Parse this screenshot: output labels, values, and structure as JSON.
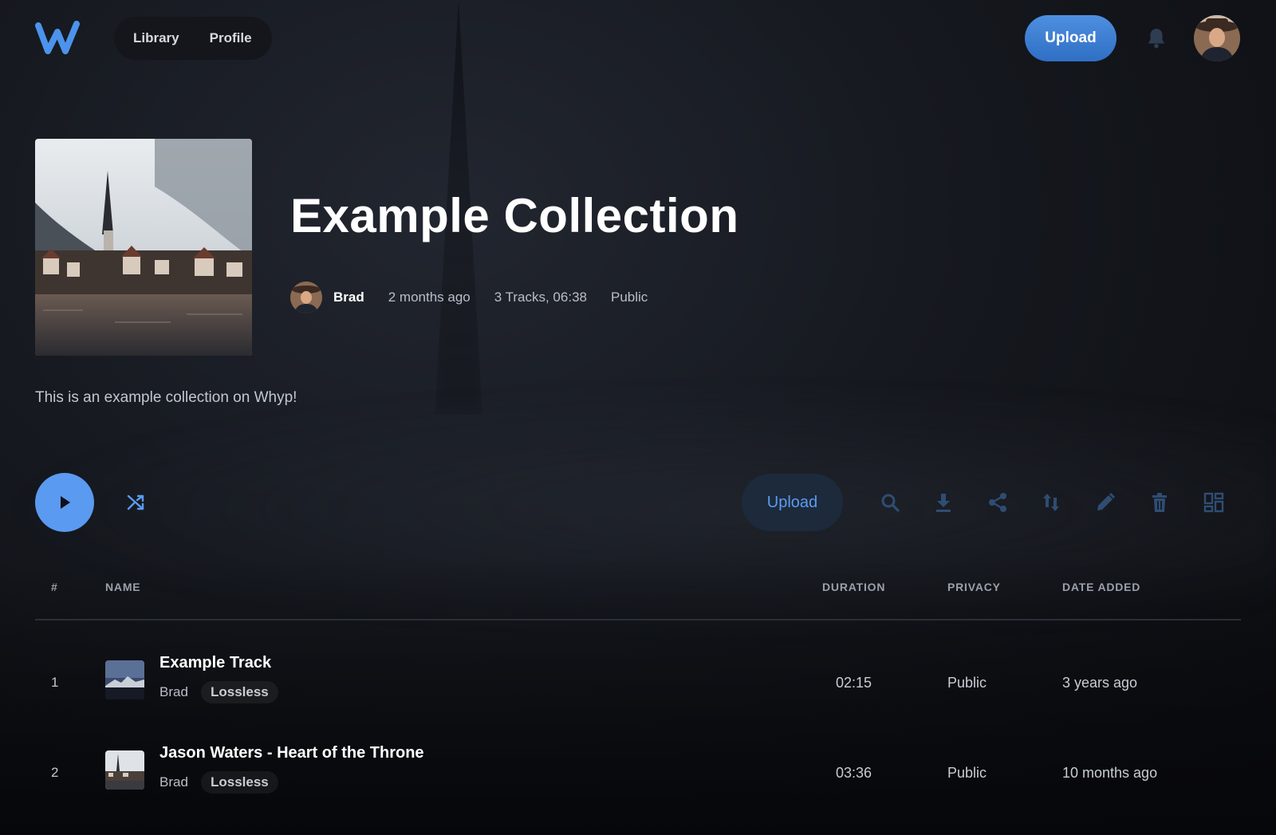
{
  "colors": {
    "accent": "#5a9af0",
    "header_upload_bg": "#3f7fd4",
    "background": "#111318"
  },
  "header": {
    "logo_icon": "whyp-w-logo-icon",
    "nav": [
      {
        "label": "Library"
      },
      {
        "label": "Profile"
      }
    ],
    "upload_label": "Upload",
    "bell_icon": "bell-icon"
  },
  "collection": {
    "title": "Example Collection",
    "owner": "Brad",
    "created": "2 months ago",
    "tracks_summary": "3 Tracks, 06:38",
    "privacy": "Public",
    "description": "This is an example collection on Whyp!"
  },
  "actions": {
    "upload_label": "Upload",
    "icons": [
      "play-icon",
      "shuffle-icon",
      "search-icon",
      "download-icon",
      "share-icon",
      "sort-icon",
      "edit-icon",
      "delete-icon",
      "grid-view-icon"
    ]
  },
  "table": {
    "headers": {
      "num": "#",
      "name": "NAME",
      "duration": "DURATION",
      "privacy": "PRIVACY",
      "date_added": "DATE ADDED"
    },
    "rows": [
      {
        "num": "1",
        "title": "Example Track",
        "artist": "Brad",
        "badge": "Lossless",
        "duration": "02:15",
        "privacy": "Public",
        "date_added": "3 years ago"
      },
      {
        "num": "2",
        "title": "Jason Waters - Heart of the Throne",
        "artist": "Brad",
        "badge": "Lossless",
        "duration": "03:36",
        "privacy": "Public",
        "date_added": "10 months ago"
      }
    ]
  }
}
